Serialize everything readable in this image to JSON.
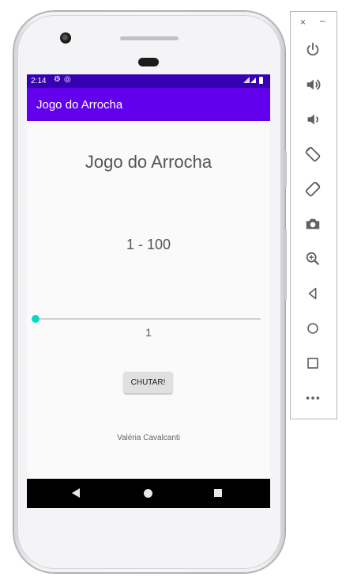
{
  "status_bar": {
    "time": "2:14"
  },
  "app_bar": {
    "title": "Jogo do Arrocha"
  },
  "main": {
    "game_title": "Jogo do Arrocha",
    "range_label": "1 - 100",
    "slider": {
      "min": 1,
      "max": 100,
      "value": 1,
      "value_text": "1"
    },
    "guess_button_label": "CHUTAR!",
    "author": "Valéria Cavalcanti"
  },
  "colors": {
    "status_bar": "#3700b3",
    "app_bar": "#6200ee",
    "accent": "#03dac5",
    "button": "#e0e0e0"
  },
  "emulator_panel": {
    "close_label": "×",
    "minimize_label": "–",
    "icons": [
      "power-icon",
      "volume-up-icon",
      "volume-down-icon",
      "rotate-left-icon",
      "rotate-right-icon",
      "camera-icon",
      "zoom-icon",
      "back-icon",
      "home-icon",
      "overview-icon",
      "more-icon"
    ]
  }
}
